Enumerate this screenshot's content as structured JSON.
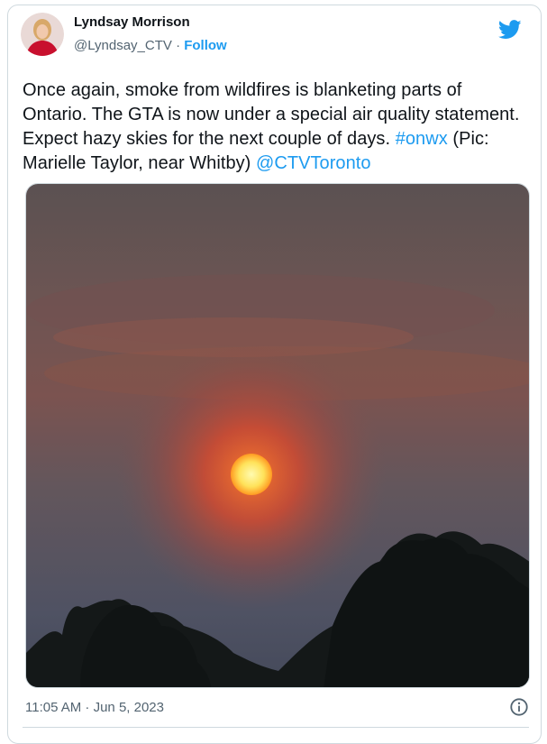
{
  "author": {
    "name": "Lyndsay Morrison",
    "handle": "@Lyndsay_CTV",
    "separator": "·",
    "follow_label": "Follow",
    "avatar_icon": "avatar-photo"
  },
  "brand": {
    "icon": "twitter-bird-icon",
    "color": "#1d9bf0"
  },
  "tweet": {
    "text_part1": "Once again, smoke from wildfires is blanketing parts of Ontario. The GTA is now under a special air quality statement. Expect hazy skies for the next couple of days. ",
    "hashtag": "#onwx",
    "text_part2": " (Pic: Marielle Taylor, near Whitby) ",
    "mention": "@CTVToronto"
  },
  "media": {
    "kind": "photo",
    "description_icon": "hazy-sunset-photo"
  },
  "footer": {
    "timestamp": "11:05 AM · Jun 5, 2023",
    "info_icon": "info-icon"
  },
  "colors": {
    "text": "#0f1419",
    "secondary": "#536471",
    "accent": "#1d9bf0",
    "border": "#cfd9de"
  }
}
